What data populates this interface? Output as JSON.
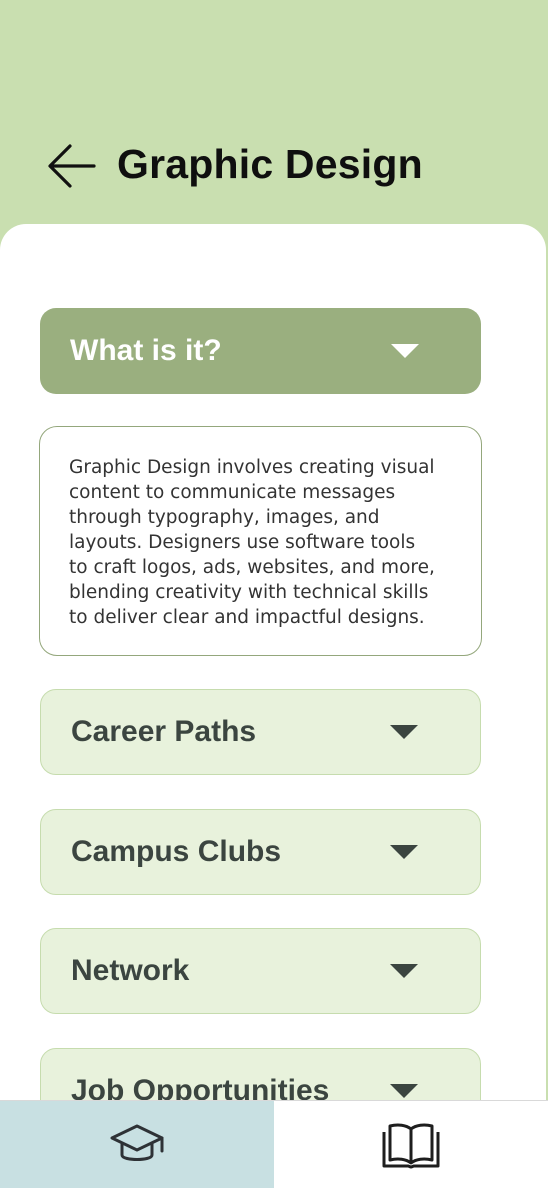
{
  "header": {
    "back_icon": "arrow-left-icon",
    "title": "Graphic Design",
    "background": "#c9dfb0"
  },
  "sections": [
    {
      "label": "What is it?",
      "expanded": true,
      "icon": "caret-down-icon"
    },
    {
      "label": "Career Paths",
      "expanded": false,
      "icon": "caret-down-icon"
    },
    {
      "label": "Campus Clubs",
      "expanded": false,
      "icon": "caret-down-icon"
    },
    {
      "label": "Network",
      "expanded": false,
      "icon": "caret-down-icon"
    },
    {
      "label": "Job Opportunities",
      "expanded": false,
      "icon": "caret-down-icon"
    }
  ],
  "description": {
    "lines": [
      "Graphic Design involves creating visual",
      "content to communicate messages",
      "through typography, images, and",
      "layouts. Designers use software tools",
      "to craft logos, ads, websites, and more,",
      "blending creativity with technical skills",
      "to deliver clear and impactful designs."
    ]
  },
  "tabbar": {
    "tabs": [
      {
        "icon": "graduation-cap-icon",
        "active": true
      },
      {
        "icon": "open-book-icon",
        "active": false
      }
    ]
  },
  "colors": {
    "accent_open": "#9aaf7f",
    "accent_closed": "#e8f2dc",
    "active_tab": "#c8e0e2"
  }
}
